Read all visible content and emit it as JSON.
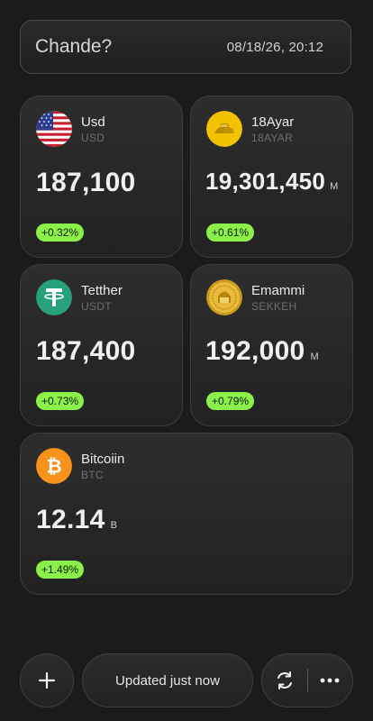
{
  "header": {
    "title": "Chande?",
    "datetime": "08/18/26, 20:12"
  },
  "cards": [
    {
      "name": "Usd",
      "code": "USD",
      "value": "187,100",
      "unit": "",
      "change": "+0.32%",
      "icon": "us-flag-icon"
    },
    {
      "name": "18Ayar",
      "code": "18AYAR",
      "value": "19,301,450",
      "unit": "M",
      "change": "+0.61%",
      "icon": "gold-bars-icon"
    },
    {
      "name": "Tetther",
      "code": "USDT",
      "value": "187,400",
      "unit": "",
      "change": "+0.73%",
      "icon": "tether-icon"
    },
    {
      "name": "Emammi",
      "code": "SEKKEH",
      "value": "192,000",
      "unit": "M",
      "change": "+0.79%",
      "icon": "gold-coin-icon"
    },
    {
      "name": "Bitcoiin",
      "code": "BTC",
      "value": "12.14",
      "unit": "B",
      "change": "+1.49%",
      "icon": "bitcoin-icon"
    }
  ],
  "footer": {
    "status": "Updated just now",
    "add_icon": "plus-icon",
    "refresh_icon": "refresh-icon",
    "more_icon": "more-dots-icon"
  },
  "colors": {
    "background": "#1b1b1b",
    "badge": "#8cf04a",
    "tether": "#26a17b",
    "bitcoin": "#f7931a",
    "gold": "#f2c200"
  }
}
